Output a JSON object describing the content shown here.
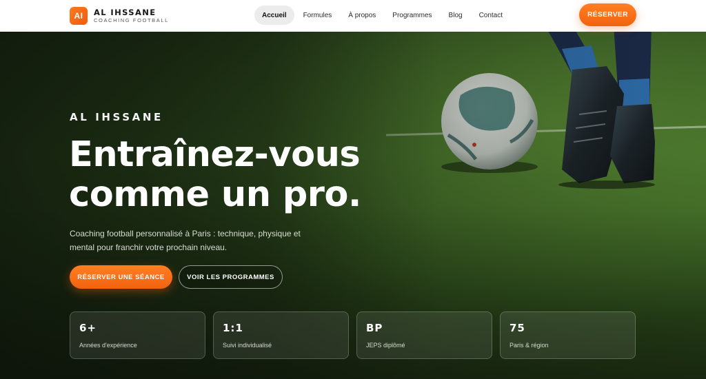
{
  "header": {
    "logo_initials": "AI",
    "brand_name": "AL IHSSANE",
    "brand_sub": "COACHING FOOTBALL",
    "nav": [
      {
        "label": "Accueil",
        "active": true
      },
      {
        "label": "Formules"
      },
      {
        "label": "À propos"
      },
      {
        "label": "Programmes"
      },
      {
        "label": "Blog"
      },
      {
        "label": "Contact"
      }
    ],
    "reserve_label": "RÉSERVER"
  },
  "hero": {
    "eyebrow": "AL IHSSANE",
    "headline_line1": "Entraînez-vous",
    "headline_line2": "comme un pro.",
    "subtitle": "Coaching football personnalisé à Paris : technique, physique et mental pour franchir votre prochain niveau.",
    "cta_primary": "RÉSERVER UNE SÉANCE",
    "cta_secondary": "VOIR LES PROGRAMMES"
  },
  "stats": [
    {
      "value": "6+",
      "label": "Années d'expérience"
    },
    {
      "value": "1:1",
      "label": "Suivi individualisé"
    },
    {
      "value": "BP",
      "label": "JEPS diplômé"
    },
    {
      "value": "75",
      "label": "Paris & région"
    }
  ],
  "colors": {
    "accent": "#f2620f",
    "accent_light": "#ff7f24",
    "header_bg": "#ffffff",
    "text_light": "#ffffff"
  }
}
